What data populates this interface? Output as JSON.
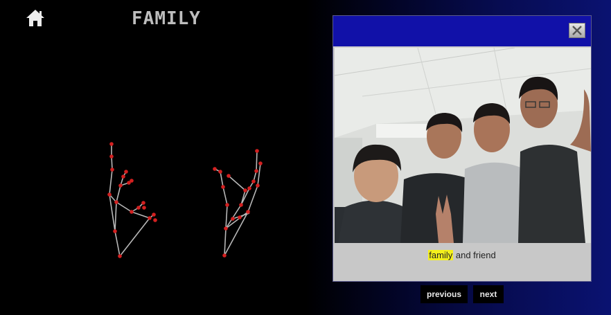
{
  "header": {
    "title": "FAMILY",
    "home_icon": "home-icon"
  },
  "popup": {
    "close_icon": "close-icon",
    "caption_highlight": "family",
    "caption_rest": " and friend",
    "highlight_color": "#f4f01c"
  },
  "nav": {
    "previous_label": "previous",
    "next_label": "next"
  },
  "colors": {
    "popup_header": "#1111a8",
    "landmark_point": "#d32020",
    "landmark_line": "#b8b8b8"
  }
}
